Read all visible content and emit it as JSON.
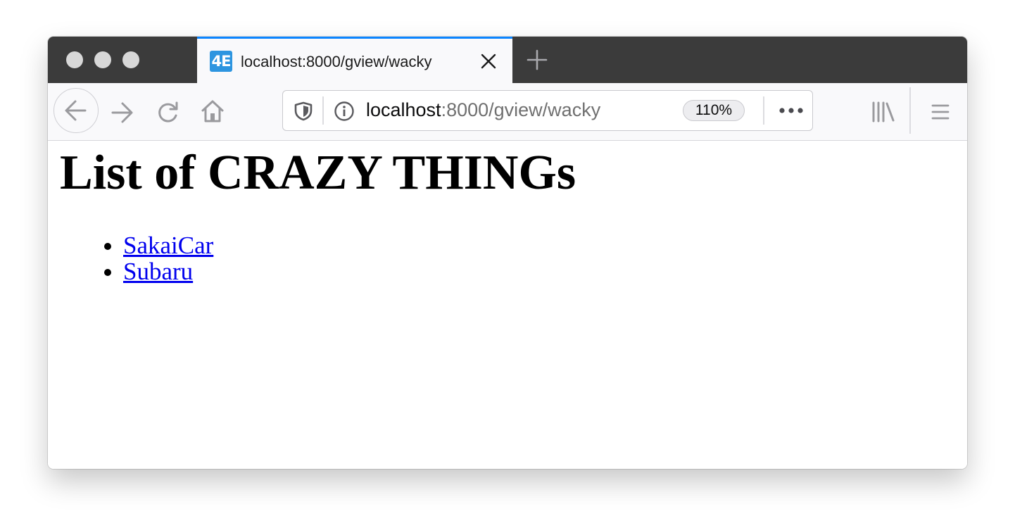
{
  "browser": {
    "tab": {
      "favicon_text": "4E",
      "title": "localhost:8000/gview/wacky"
    },
    "address_bar": {
      "host": "localhost",
      "path": ":8000/gview/wacky",
      "zoom": "110%"
    },
    "icons": {
      "back": "back-arrow-icon",
      "forward": "forward-arrow-icon",
      "reload": "reload-icon",
      "home": "home-icon",
      "shield": "tracking-protection-shield-icon",
      "info": "site-info-icon",
      "page_actions": "more-dots-icon",
      "library": "library-icon",
      "menu": "hamburger-menu-icon",
      "close_tab": "close-icon",
      "new_tab": "plus-icon"
    },
    "accent_color": "#0a84ff"
  },
  "page": {
    "heading": "List of CRAZY THINGs",
    "links": [
      {
        "label": "SakaiCar"
      },
      {
        "label": "Subaru"
      }
    ],
    "link_color": "#0000ee"
  }
}
